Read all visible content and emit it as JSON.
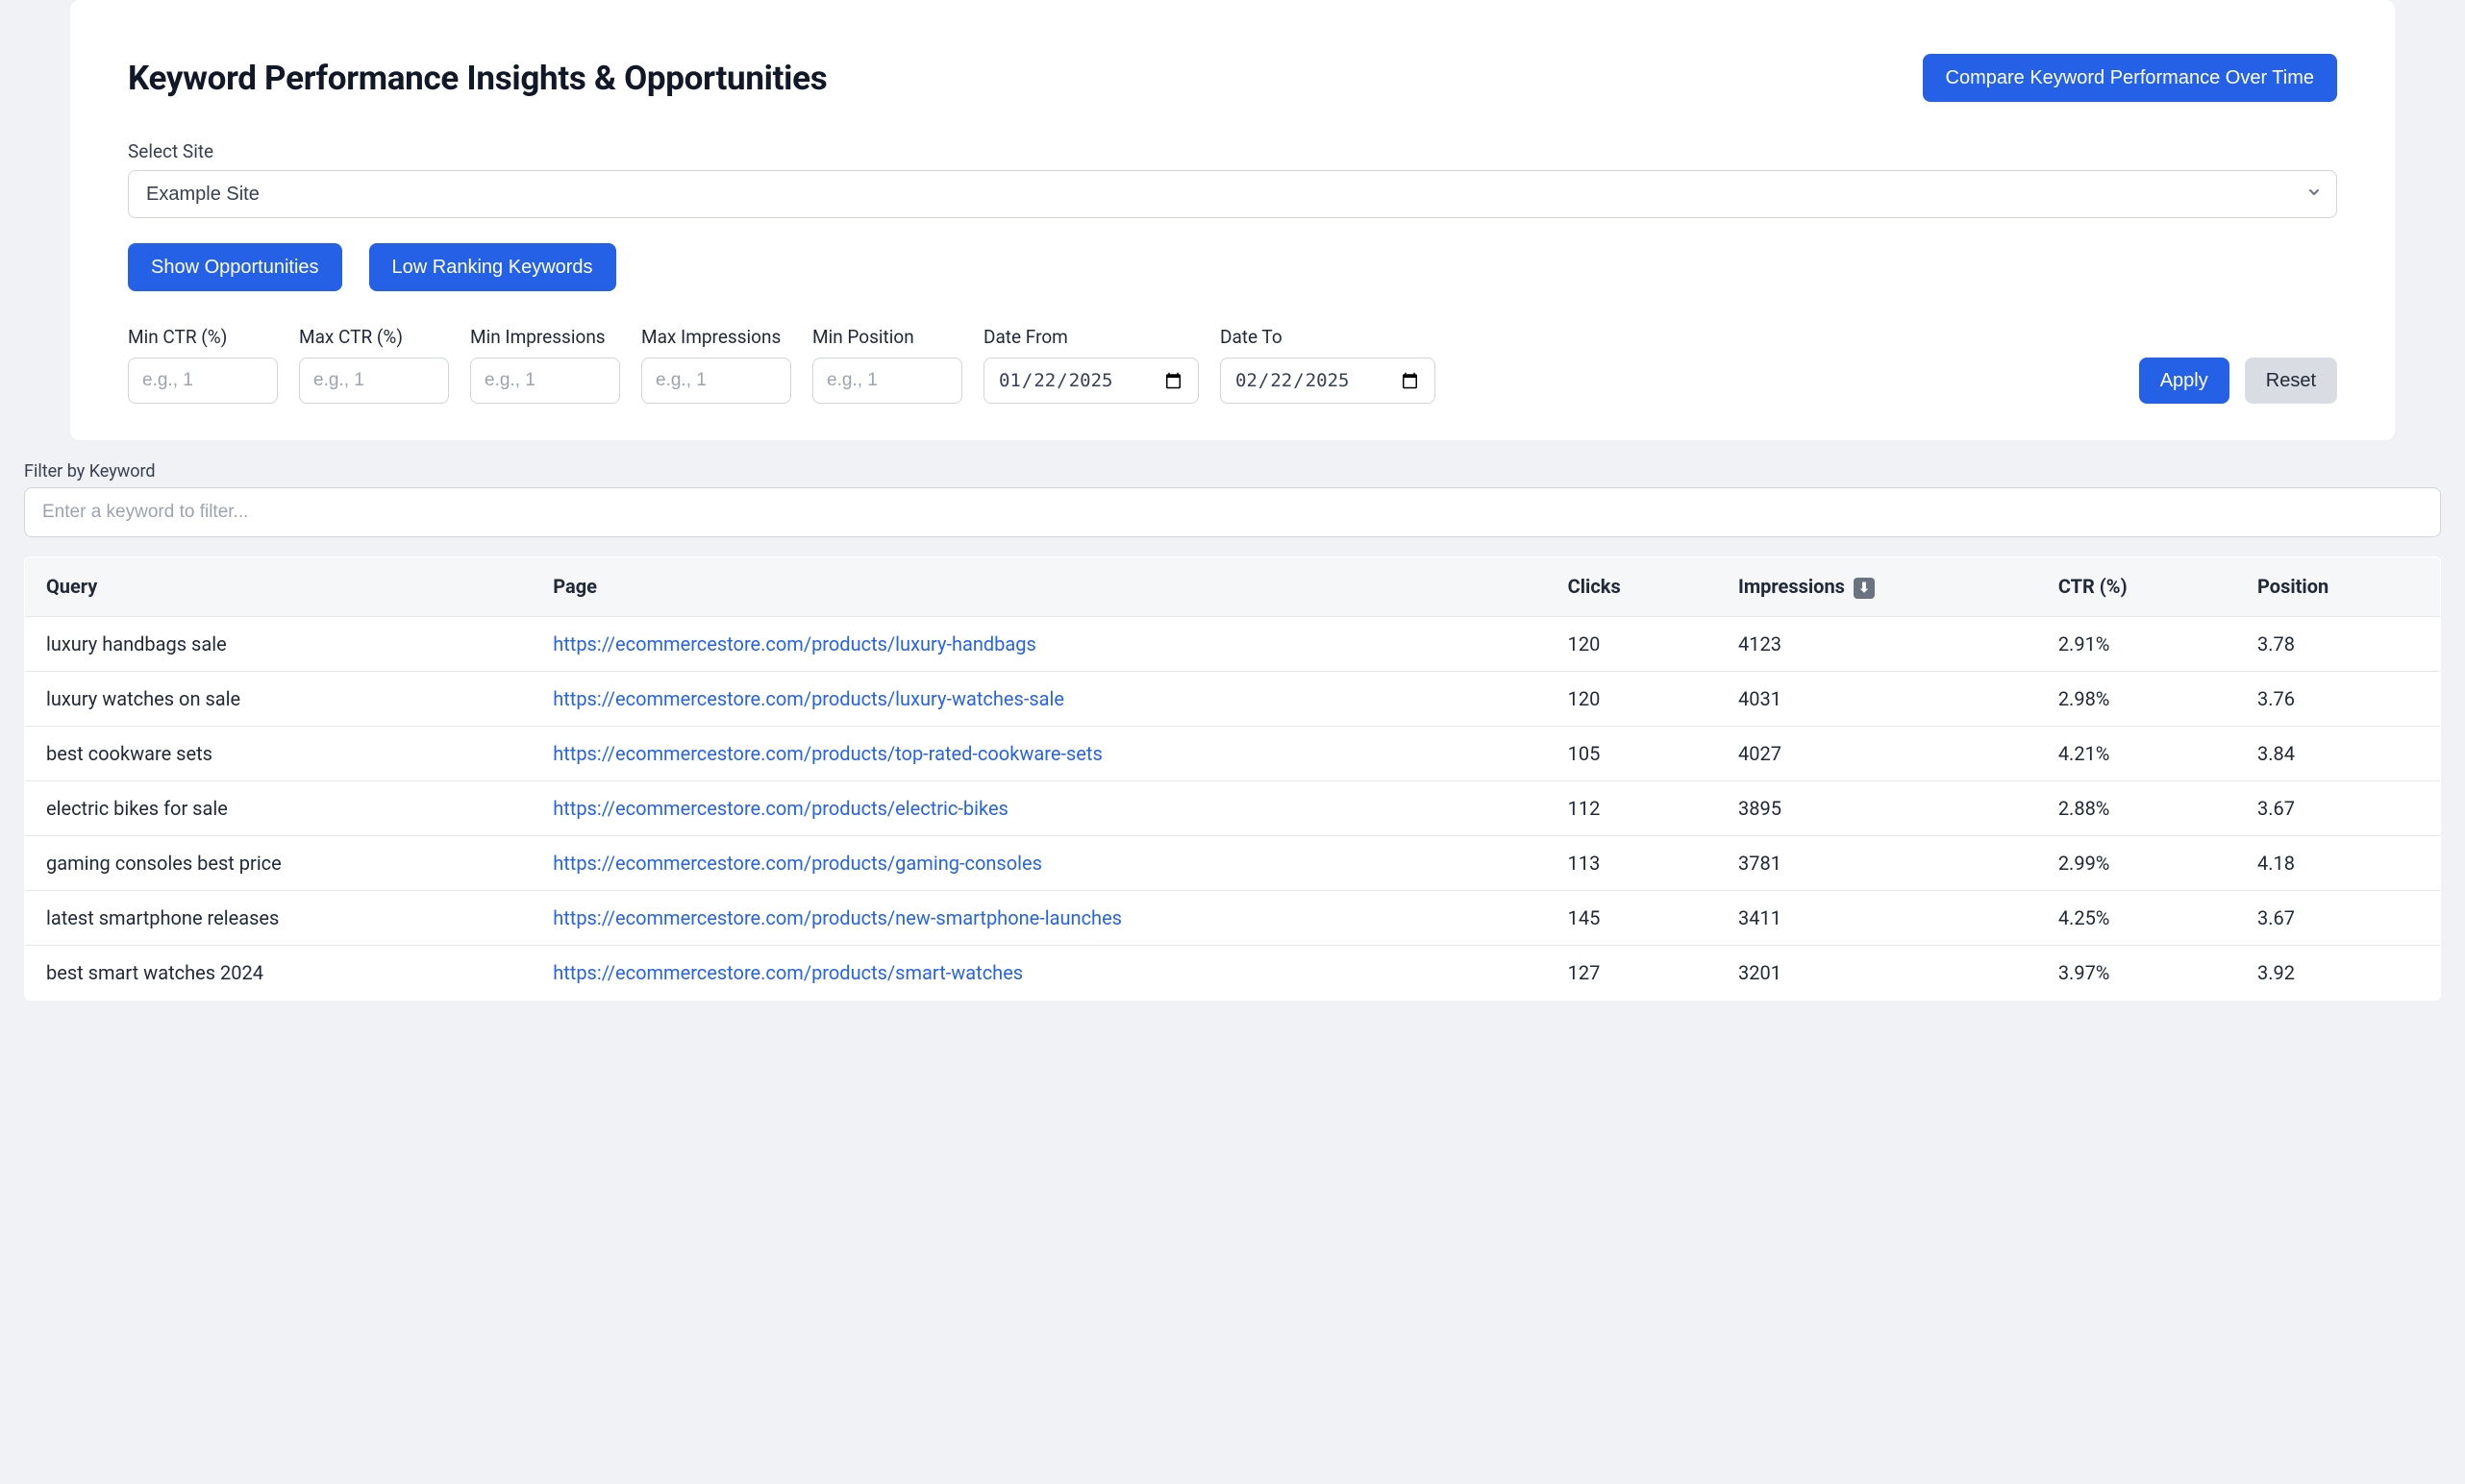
{
  "header": {
    "title": "Keyword Performance Insights & Opportunities",
    "compare_button": "Compare Keyword Performance Over Time"
  },
  "site_select": {
    "label": "Select Site",
    "value": "Example Site"
  },
  "actions": {
    "show_opportunities": "Show Opportunities",
    "low_ranking": "Low Ranking Keywords"
  },
  "filters": {
    "min_ctr": {
      "label": "Min CTR (%)",
      "placeholder": "e.g., 1"
    },
    "max_ctr": {
      "label": "Max CTR (%)",
      "placeholder": "e.g., 1"
    },
    "min_impr": {
      "label": "Min Impressions",
      "placeholder": "e.g., 1"
    },
    "max_impr": {
      "label": "Max Impressions",
      "placeholder": "e.g., 1"
    },
    "min_pos": {
      "label": "Min Position",
      "placeholder": "e.g., 1"
    },
    "date_from": {
      "label": "Date From",
      "value": "2025-01-22"
    },
    "date_to": {
      "label": "Date To",
      "value": "2025-02-22"
    },
    "apply": "Apply",
    "reset": "Reset"
  },
  "keyword_filter": {
    "label": "Filter by Keyword",
    "placeholder": "Enter a keyword to filter..."
  },
  "table": {
    "columns": {
      "query": "Query",
      "page": "Page",
      "clicks": "Clicks",
      "impressions": "Impressions",
      "ctr": "CTR (%)",
      "position": "Position"
    },
    "sort_icon": "⬇",
    "rows": [
      {
        "query": "luxury handbags sale",
        "page": "https://ecommercestore.com/products/luxury-handbags",
        "clicks": "120",
        "impressions": "4123",
        "ctr": "2.91%",
        "position": "3.78"
      },
      {
        "query": "luxury watches on sale",
        "page": "https://ecommercestore.com/products/luxury-watches-sale",
        "clicks": "120",
        "impressions": "4031",
        "ctr": "2.98%",
        "position": "3.76"
      },
      {
        "query": "best cookware sets",
        "page": "https://ecommercestore.com/products/top-rated-cookware-sets",
        "clicks": "105",
        "impressions": "4027",
        "ctr": "4.21%",
        "position": "3.84"
      },
      {
        "query": "electric bikes for sale",
        "page": "https://ecommercestore.com/products/electric-bikes",
        "clicks": "112",
        "impressions": "3895",
        "ctr": "2.88%",
        "position": "3.67"
      },
      {
        "query": "gaming consoles best price",
        "page": "https://ecommercestore.com/products/gaming-consoles",
        "clicks": "113",
        "impressions": "3781",
        "ctr": "2.99%",
        "position": "4.18"
      },
      {
        "query": "latest smartphone releases",
        "page": "https://ecommercestore.com/products/new-smartphone-launches",
        "clicks": "145",
        "impressions": "3411",
        "ctr": "4.25%",
        "position": "3.67"
      },
      {
        "query": "best smart watches 2024",
        "page": "https://ecommercestore.com/products/smart-watches",
        "clicks": "127",
        "impressions": "3201",
        "ctr": "3.97%",
        "position": "3.92"
      }
    ]
  }
}
